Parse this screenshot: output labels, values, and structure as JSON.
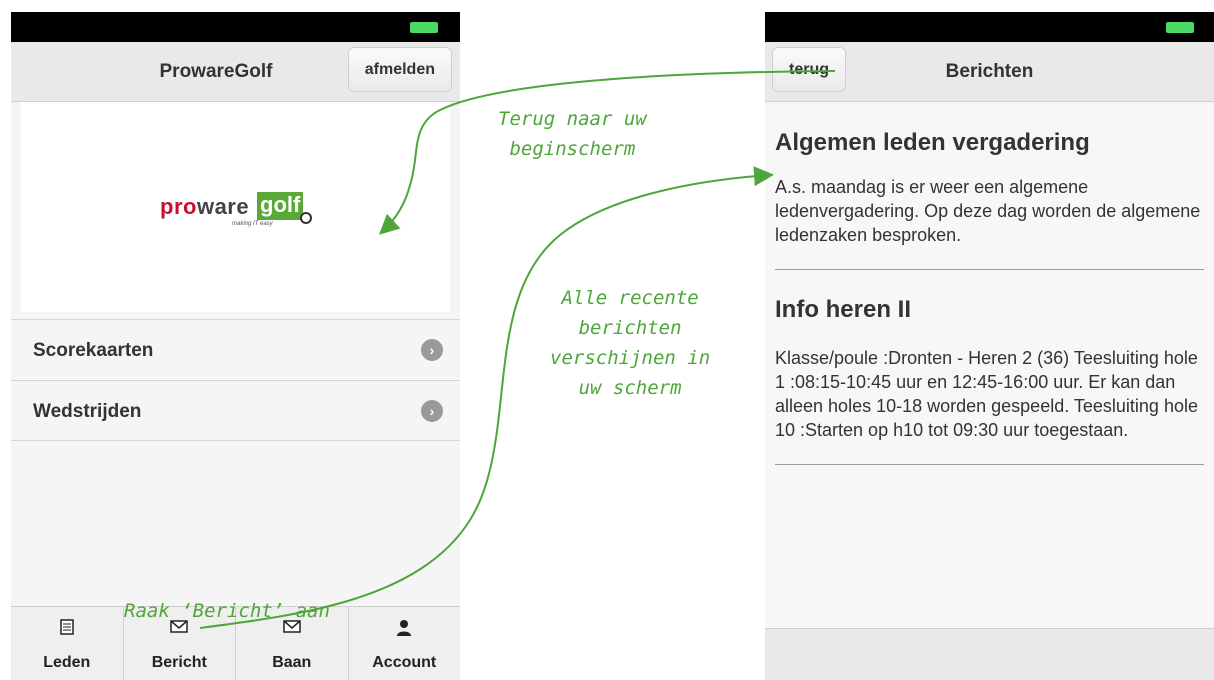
{
  "left_screen": {
    "header": {
      "title": "ProwareGolf",
      "logout_label": "afmelden"
    },
    "logo": {
      "pro": "pro",
      "ware": "ware",
      "golf": "golf",
      "tagline": "making IT easy"
    },
    "menu": [
      {
        "label": "Scorekaarten"
      },
      {
        "label": "Wedstrijden"
      }
    ],
    "tabs": [
      {
        "label": "Leden",
        "icon": "document-icon"
      },
      {
        "label": "Bericht",
        "icon": "envelope-icon"
      },
      {
        "label": "Baan",
        "icon": "envelope-icon"
      },
      {
        "label": "Account",
        "icon": "person-icon"
      }
    ]
  },
  "right_screen": {
    "header": {
      "title": "Berichten",
      "back_label": "terug"
    },
    "messages": [
      {
        "title": "Algemen leden vergadering",
        "body": "A.s. maandag is er weer een algemene ledenvergadering. Op deze dag worden de algemene ledenzaken besproken."
      },
      {
        "title": "Info heren II",
        "body": "Klasse/poule :Dronten - Heren 2 (36) Teesluiting hole 1 :08:15-10:45 uur en 12:45-16:00 uur. Er kan dan alleen holes 10-18 worden gespeeld. Teesluiting hole 10 :Starten op h10 tot 09:30 uur toegestaan."
      }
    ]
  },
  "annotations": {
    "back_line1": "Terug naar uw",
    "back_line2": "beginscherm",
    "recent_line1": "Alle recente",
    "recent_line2": "berichten",
    "recent_line3": "verschijnen in",
    "recent_line4": "uw scherm",
    "tap": "Raak ‘Bericht’ aan"
  },
  "colors": {
    "annotation": "#4ea63a",
    "battery": "#4cd964"
  }
}
